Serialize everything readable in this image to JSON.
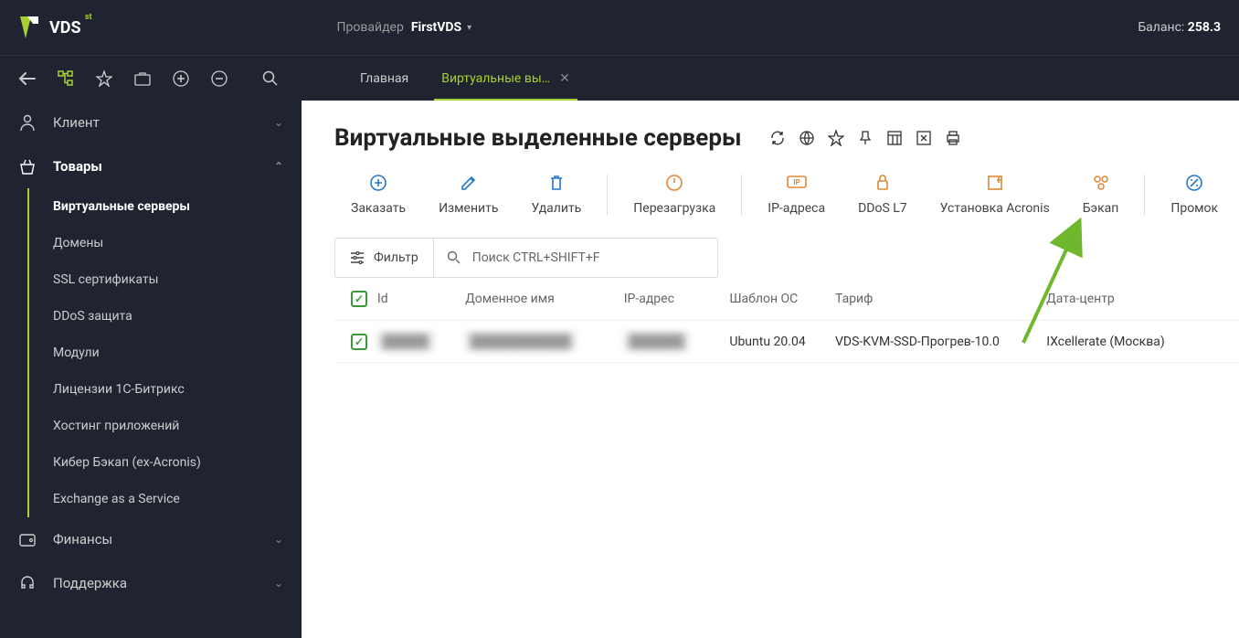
{
  "header": {
    "logo_text": "VDS",
    "logo_sup": "st",
    "provider_label": "Провайдер",
    "provider_name": "FirstVDS",
    "balance_label": "Баланс:",
    "balance_value": "258.3"
  },
  "tabs": [
    {
      "label": "Главная",
      "active": false,
      "closable": false
    },
    {
      "label": "Виртуальные вы…",
      "active": true,
      "closable": true
    }
  ],
  "sidebar": {
    "groups": [
      {
        "icon": "user",
        "label": "Клиент",
        "expanded": false,
        "bold": false
      },
      {
        "icon": "basket",
        "label": "Товары",
        "expanded": true,
        "bold": true,
        "items": [
          {
            "label": "Виртуальные серверы",
            "active": true
          },
          {
            "label": "Домены",
            "active": false
          },
          {
            "label": "SSL сертификаты",
            "active": false
          },
          {
            "label": "DDoS защита",
            "active": false
          },
          {
            "label": "Модули",
            "active": false
          },
          {
            "label": "Лицензии 1С-Битрикс",
            "active": false
          },
          {
            "label": "Хостинг приложений",
            "active": false
          },
          {
            "label": "Кибер Бэкап (ex-Acronis)",
            "active": false
          },
          {
            "label": "Exchange as a Service",
            "active": false
          }
        ]
      },
      {
        "icon": "wallet",
        "label": "Финансы",
        "expanded": false,
        "bold": false
      },
      {
        "icon": "headset",
        "label": "Поддержка",
        "expanded": false,
        "bold": false
      }
    ]
  },
  "page": {
    "title": "Виртуальные выделенные серверы"
  },
  "actions": [
    {
      "label": "Заказать",
      "icon": "plus-circle",
      "color": "blue"
    },
    {
      "label": "Изменить",
      "icon": "edit",
      "color": "blue"
    },
    {
      "label": "Удалить",
      "icon": "trash",
      "color": "blue"
    },
    {
      "sep": true
    },
    {
      "label": "Перезагрузка",
      "icon": "power",
      "color": "orange"
    },
    {
      "sep": true
    },
    {
      "label": "IP-адреса",
      "icon": "ip",
      "color": "orange"
    },
    {
      "label": "DDoS L7",
      "icon": "shield-lock",
      "color": "orange"
    },
    {
      "label": "Установка Acronis",
      "icon": "install",
      "color": "orange"
    },
    {
      "label": "Бэкап",
      "icon": "backup",
      "color": "orange"
    },
    {
      "sep": true
    },
    {
      "label": "Промок",
      "icon": "percent",
      "color": "blue"
    }
  ],
  "filter": {
    "filter_label": "Фильтр",
    "search_placeholder": "Поиск CTRL+SHIFT+F"
  },
  "table": {
    "columns": [
      "Id",
      "Доменное имя",
      "IP-адрес",
      "Шаблон ОС",
      "Тариф",
      "Дата-центр"
    ],
    "rows": [
      {
        "checked": true,
        "id": "█████",
        "domain": "███████████",
        "ip": "██████",
        "os": "Ubuntu 20.04",
        "tariff": "VDS-KVM-SSD-Прогрев-10.0",
        "dc": "IXcellerate (Москва)"
      }
    ]
  }
}
